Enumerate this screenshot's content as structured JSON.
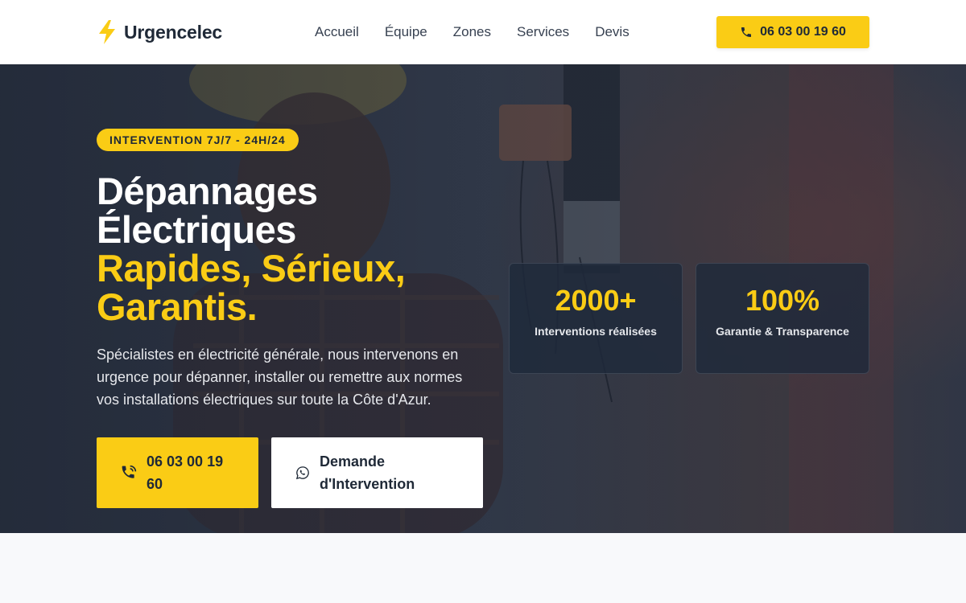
{
  "header": {
    "brand": "Urgencelec",
    "nav": [
      {
        "label": "Accueil"
      },
      {
        "label": "Équipe"
      },
      {
        "label": "Zones"
      },
      {
        "label": "Services"
      },
      {
        "label": "Devis"
      }
    ],
    "cta_phone": "06 03 00 19 60"
  },
  "hero": {
    "badge": "INTERVENTION 7J/7 - 24H/24",
    "title_line1": "Dépannages",
    "title_line2": "Électriques",
    "title_accent1": "Rapides, Sérieux,",
    "title_accent2": "Garantis.",
    "description": "Spécialistes en électricité générale, nous intervenons en urgence pour dépanner, installer ou remettre aux normes vos installations électriques sur toute la Côte d'Azur.",
    "call_button": "06 03 00 19 60",
    "request_button": "Demande d'Intervention",
    "stats": [
      {
        "value": "2000+",
        "label": "Interventions réalisées"
      },
      {
        "value": "100%",
        "label": "Garantie & Transparence"
      }
    ]
  },
  "colors": {
    "accent": "#facc15",
    "dark": "#1f2937",
    "hero_overlay": "#1e2636"
  },
  "icons": {
    "logo": "lightning-bolt-icon",
    "phone": "phone-icon",
    "phone_ring": "phone-ringing-icon",
    "whatsapp": "whatsapp-icon"
  }
}
